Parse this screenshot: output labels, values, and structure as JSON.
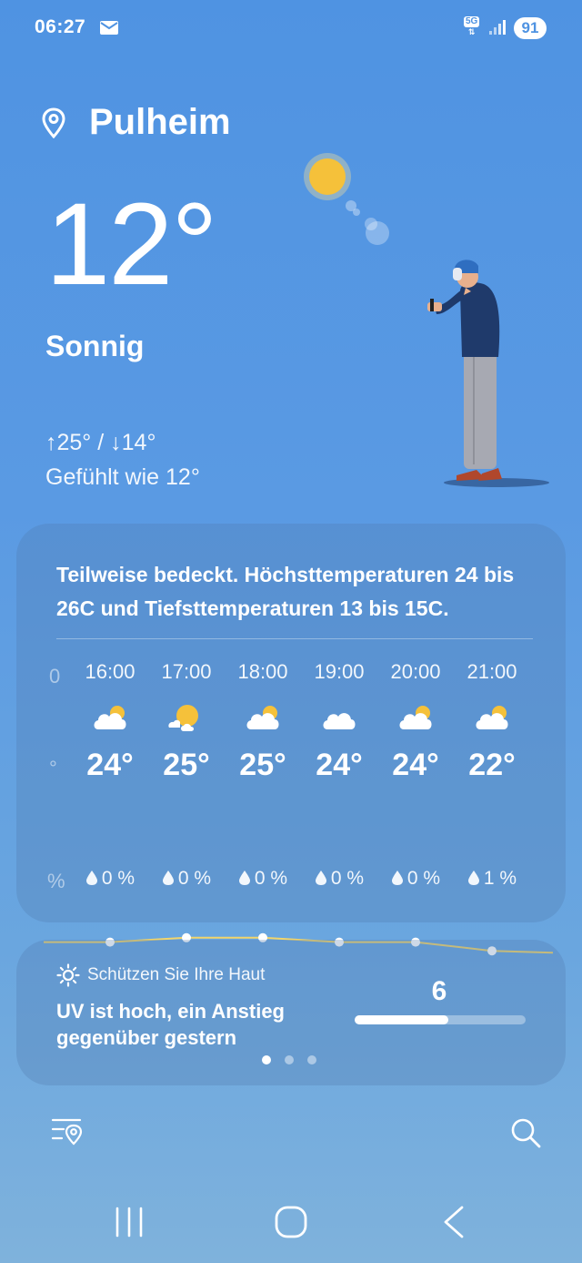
{
  "status_bar": {
    "time": "06:27",
    "network": "5G",
    "battery": "91"
  },
  "location": {
    "city": "Pulheim"
  },
  "current": {
    "temperature": "12°",
    "condition": "Sonnig",
    "hilo": "↑25° / ↓14°",
    "feels_like": "Gefühlt wie 12°"
  },
  "forecast_card": {
    "summary": "Teilweise bedeckt. Höchsttemperaturen 24 bis 26C und Tiefsttemperaturen 13 bis 15C.",
    "hours": [
      {
        "time": "16:00",
        "icon": "partly-cloudy-icon",
        "temp": "24°",
        "rain": "0 %",
        "temp_value": 24
      },
      {
        "time": "17:00",
        "icon": "sunny-cloud-icon",
        "temp": "25°",
        "rain": "0 %",
        "temp_value": 25
      },
      {
        "time": "18:00",
        "icon": "partly-cloudy-icon",
        "temp": "25°",
        "rain": "0 %",
        "temp_value": 25
      },
      {
        "time": "19:00",
        "icon": "cloudy-icon",
        "temp": "24°",
        "rain": "0 %",
        "temp_value": 24
      },
      {
        "time": "20:00",
        "icon": "partly-cloudy-icon",
        "temp": "24°",
        "rain": "0 %",
        "temp_value": 24
      },
      {
        "time": "21:00",
        "icon": "partly-cloudy-icon",
        "temp": "22°",
        "rain": "1 %",
        "temp_value": 22
      }
    ],
    "left_edge_fragments": {
      "time": "0",
      "temp": "°",
      "rain": "%"
    },
    "line_color": "#f2d56b"
  },
  "uv_card": {
    "heading": "Schützen Sie Ihre Haut",
    "text": "UV ist hoch, ein Anstieg gegenüber gestern",
    "value": "6",
    "level_fraction": 0.55,
    "page_count": 3,
    "active_page": 0
  },
  "colors": {
    "background_top": "#4f93e2",
    "accent_sun": "#f5c13a"
  }
}
